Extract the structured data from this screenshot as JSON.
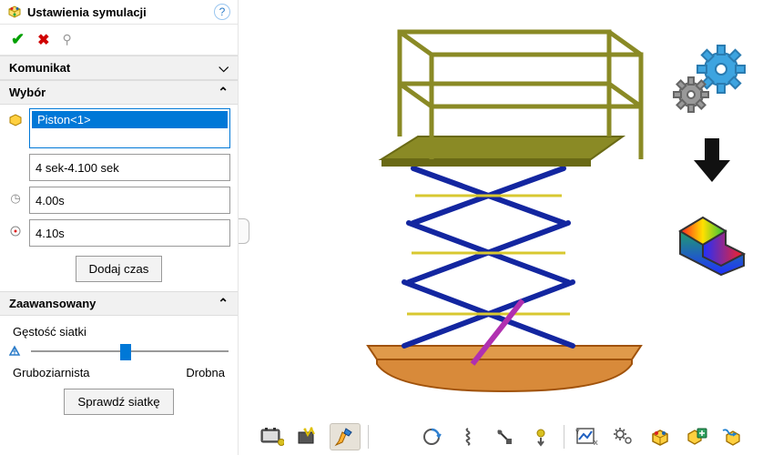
{
  "header": {
    "title": "Ustawienia symulacji"
  },
  "sections": {
    "komunikat": {
      "label": "Komunikat"
    },
    "wybor": {
      "label": "Wybór",
      "selected_item": "Piston<1>",
      "time_range": "4 sek-4.100 sek",
      "t_start": "4.00s",
      "t_end": "4.10s",
      "add_button": "Dodaj czas"
    },
    "adv": {
      "label": "Zaawansowany",
      "mesh_density": "Gęstość siatki",
      "coarse": "Gruboziarnista",
      "fine": "Drobna",
      "check_mesh": "Sprawdź siatkę"
    }
  }
}
